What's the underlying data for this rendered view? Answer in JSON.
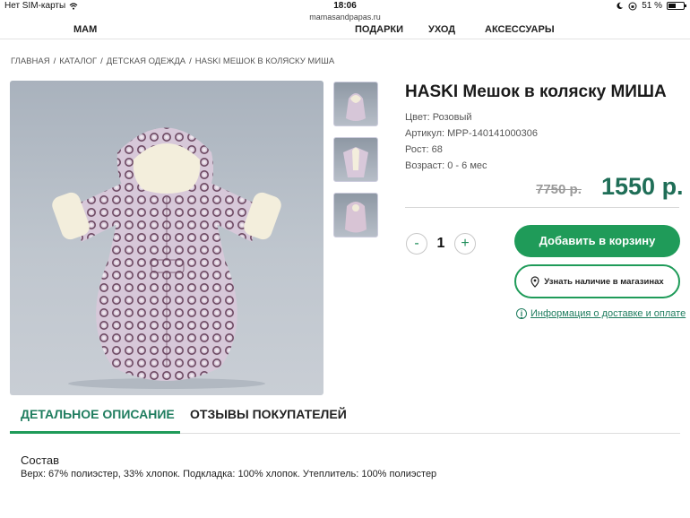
{
  "status_bar": {
    "carrier": "Нет SIM-карты",
    "time": "18:06",
    "battery": "51 %",
    "battery_level": 0.51
  },
  "browser": {
    "url": "mamasandpapas.ru"
  },
  "site_nav": {
    "left_label": "МАМ",
    "items": [
      "ПОДАРКИ",
      "УХОД",
      "АКСЕССУАРЫ"
    ]
  },
  "breadcrumb": {
    "items": [
      "ГЛАВНАЯ",
      "КАТАЛОГ",
      "ДЕТСКАЯ ОДЕЖДА",
      "HASKI МЕШОК В КОЛЯСКУ МИША"
    ],
    "separator": "/"
  },
  "product": {
    "title": "HASKI Мешок в коляску МИША",
    "color": "Цвет: Розовый",
    "sku": "Артикул: MPP-140141000306",
    "height": "Рост: 68",
    "age": "Возраст: 0 - 6 мес",
    "old_price": "7750 р.",
    "price": "1550 р."
  },
  "quantity": {
    "minus": "-",
    "value": "1",
    "plus": "+"
  },
  "actions": {
    "add_to_cart": "Добавить в корзину",
    "check_stores": "Узнать наличие в магазинах",
    "delivery_info": "Информация о доставке и оплате"
  },
  "tabs": [
    {
      "label": "ДЕТАЛЬНОЕ ОПИСАНИЕ",
      "active": true
    },
    {
      "label": "ОТЗЫВЫ ПОКУПАТЕЛЕЙ",
      "active": false
    }
  ],
  "description": {
    "heading": "Состав",
    "text": "Верх: 67% полиэстер, 33% хлопок. Подкладка: 100% хлопок. Утеплитель: 100% полиэстер"
  },
  "colors": {
    "accent": "#1f9b59",
    "price": "#1f6e57",
    "link": "#1f7d5f"
  }
}
